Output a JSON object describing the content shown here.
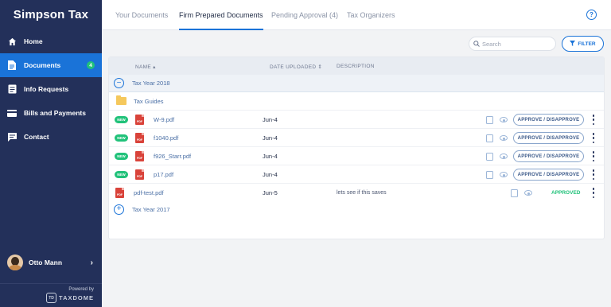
{
  "sidebar": {
    "brand": "Simpson Tax",
    "items": [
      {
        "label": "Home",
        "icon": "home-icon"
      },
      {
        "label": "Documents",
        "icon": "document-icon",
        "badge": "4",
        "active": true
      },
      {
        "label": "Info Requests",
        "icon": "info-request-icon"
      },
      {
        "label": "Bills and Payments",
        "icon": "credit-card-icon"
      },
      {
        "label": "Contact",
        "icon": "chat-icon"
      }
    ],
    "profile": {
      "name": "Otto Mann"
    },
    "powered_by": "Powered by",
    "vendor": "TAXDOME",
    "vendor_logo": "TD"
  },
  "tabs": [
    {
      "label": "Your Documents"
    },
    {
      "label": "Firm Prepared Documents",
      "active": true
    },
    {
      "label": "Pending Approval (4)"
    },
    {
      "label": "Tax Organizers"
    }
  ],
  "toolbar": {
    "help": "?",
    "search_placeholder": "Search",
    "filter_label": "FILTER"
  },
  "table": {
    "columns": {
      "name": "NAME",
      "date": "DATE UPLOADED",
      "description": "DESCRIPTION"
    },
    "groups": [
      {
        "label": "Tax Year 2018",
        "expanded": true
      },
      {
        "label": "Tax Year 2017",
        "expanded": false
      }
    ],
    "folder": {
      "name": "Tax Guides"
    },
    "rows": [
      {
        "badge": "NEW",
        "name": "W-9.pdf",
        "date": "Jun-4",
        "description": "",
        "action": "APPROVE / DISAPPROVE"
      },
      {
        "badge": "NEW",
        "name": "f1040.pdf",
        "date": "Jun-4",
        "description": "",
        "action": "APPROVE / DISAPPROVE"
      },
      {
        "badge": "NEW",
        "name": "f926_Starr.pdf",
        "date": "Jun-4",
        "description": "",
        "action": "APPROVE / DISAPPROVE"
      },
      {
        "badge": "NEW",
        "name": "p17.pdf",
        "date": "Jun-4",
        "description": "",
        "action": "APPROVE / DISAPPROVE"
      },
      {
        "badge": "",
        "name": "pdf-test.pdf",
        "date": "Jun-5",
        "description": "lets see if this saves",
        "status": "APPROVED"
      }
    ],
    "file_type": "PDF"
  },
  "colors": {
    "sidebar": "#23305a",
    "accent": "#1a73d8",
    "success": "#21c27a",
    "pdf": "#d9433a"
  }
}
